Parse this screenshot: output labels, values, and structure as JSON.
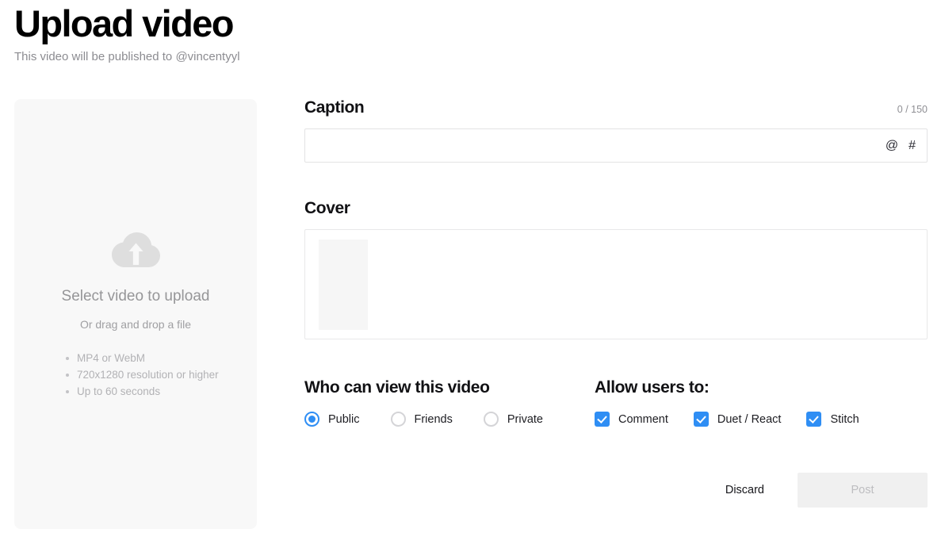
{
  "header": {
    "title": "Upload video",
    "subtitle": "This video will be published to @vincentyyl"
  },
  "upload_panel": {
    "icon": "cloud-upload-icon",
    "main_text": "Select video to upload",
    "sub_text": "Or drag and drop a file",
    "requirements": [
      "MP4 or WebM",
      "720x1280 resolution or higher",
      "Up to 60 seconds"
    ]
  },
  "caption": {
    "title": "Caption",
    "counter": "0 / 150",
    "value": "",
    "placeholder": "",
    "mention_icon": "@",
    "hashtag_icon": "#"
  },
  "cover": {
    "title": "Cover",
    "thumbnail_label": ""
  },
  "privacy": {
    "title": "Who can view this video",
    "options": [
      {
        "label": "Public",
        "selected": true
      },
      {
        "label": "Friends",
        "selected": false
      },
      {
        "label": "Private",
        "selected": false
      }
    ]
  },
  "permissions": {
    "title": "Allow users to:",
    "options": [
      {
        "label": "Comment",
        "checked": true
      },
      {
        "label": "Duet / React",
        "checked": true
      },
      {
        "label": "Stitch",
        "checked": true
      }
    ]
  },
  "actions": {
    "discard_label": "Discard",
    "post_label": "Post",
    "post_disabled": true
  },
  "colors": {
    "accent": "#2f8ef4",
    "panel_bg": "#f8f8f8",
    "text_primary": "#111114",
    "text_muted": "#8c8c91",
    "border": "#e3e3e4",
    "post_disabled_bg": "#f0f0f0",
    "post_disabled_text": "#bdbdc0"
  }
}
